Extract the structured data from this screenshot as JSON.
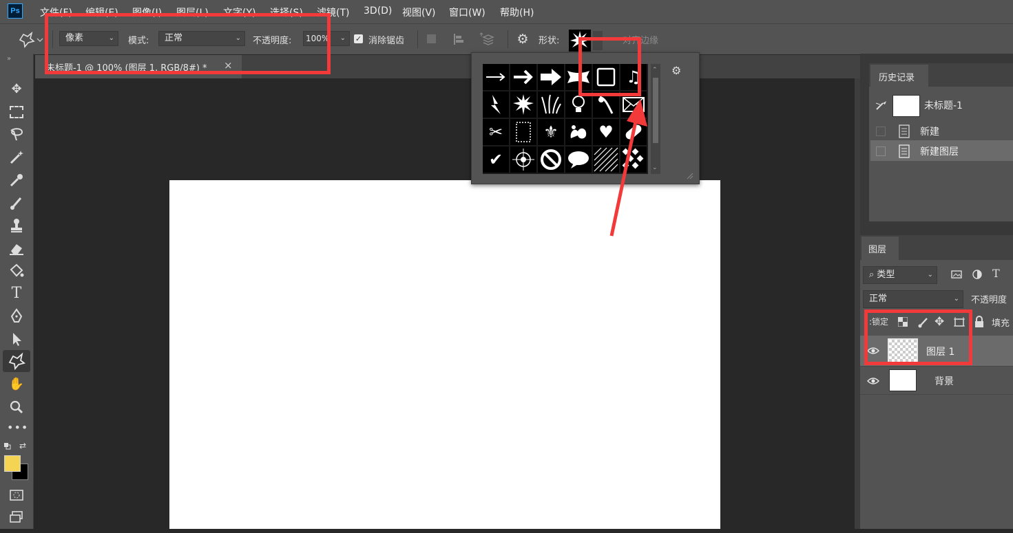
{
  "app": {
    "logo_text": "Ps"
  },
  "menu": [
    "文件(F)",
    "编辑(E)",
    "图像(I)",
    "图层(L)",
    "文字(Y)",
    "选择(S)",
    "滤镜(T)",
    "3D(D)",
    "视图(V)",
    "窗口(W)",
    "帮助(H)"
  ],
  "options": {
    "tool_mode": "像素",
    "mode_label": "模式:",
    "mode_value": "正常",
    "opacity_label": "不透明度:",
    "opacity_value": "100%",
    "antialias_label": "消除锯齿",
    "antialias_checked": true,
    "shape_label": "形状:",
    "align_edges_label": "对齐边缘"
  },
  "document_tab": {
    "title": "未标题-1 @ 100% (图层 1, RGB/8#) *",
    "close": "×"
  },
  "shape_picker": {
    "shapes": [
      "arrow-thin",
      "arrow-medium",
      "arrow-bold",
      "banner",
      "frame",
      "music-note",
      "lightning",
      "starburst",
      "grass",
      "lightbulb",
      "fern",
      "envelope",
      "scissors",
      "stamp-frame",
      "fleur-de-lis",
      "ornament",
      "heart",
      "bandage",
      "checkmark",
      "crosshair",
      "prohibited",
      "speech-bubble",
      "hatch",
      "checker"
    ],
    "selected_index": 4
  },
  "history": {
    "tab_label": "历史记录",
    "snapshot": "未标题-1",
    "items": [
      "新建",
      "新建图层"
    ]
  },
  "layers": {
    "tab_label": "图层",
    "filter_label": "类型",
    "blend_mode": "正常",
    "opacity_label": "不透明度",
    "lock_label": "锁定:",
    "fill_label": "填充",
    "items": [
      {
        "name": "图层 1",
        "selected": true
      },
      {
        "name": "背景",
        "selected": false
      }
    ]
  },
  "colors": {
    "foreground": "#f5d453",
    "background": "#000000",
    "annotation": "#f23a3a"
  }
}
